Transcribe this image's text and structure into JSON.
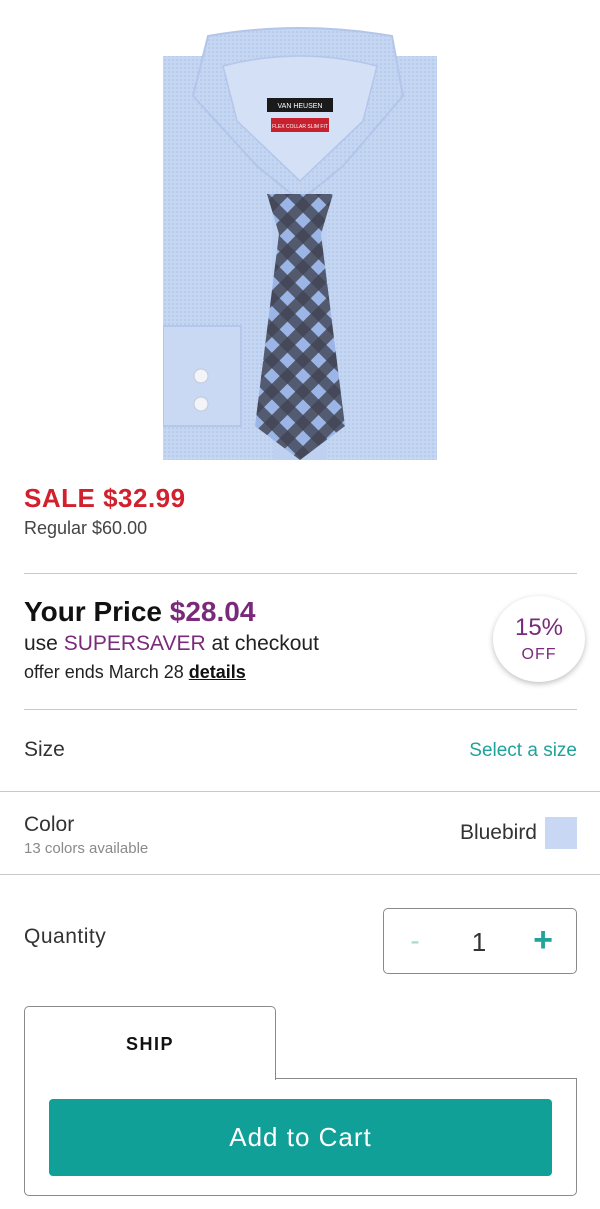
{
  "product": {
    "image_icon": "dress-shirt-with-tie-image",
    "brand_tag": "VAN HEUSEN",
    "fit_tag": "FLEX COLLAR SLIM FIT"
  },
  "pricing": {
    "sale": "SALE $32.99",
    "regular": "Regular $60.00",
    "your_price_label": "Your Price",
    "your_price_amount": "$28.04",
    "promo_prefix": "use",
    "promo_code": "SUPERSAVER",
    "promo_suffix": "at checkout",
    "offer_text": "offer ends March 28",
    "details_link": "details",
    "badge_percent": "15%",
    "badge_off": "OFF"
  },
  "size": {
    "label": "Size",
    "select_label": "Select a size"
  },
  "color": {
    "label": "Color",
    "available": "13 colors available",
    "value": "Bluebird",
    "swatch_color": "#c8d8f4"
  },
  "quantity": {
    "label": "Quantity",
    "minus": "-",
    "value": "1",
    "plus": "+"
  },
  "fulfillment": {
    "tab_label": "SHIP",
    "add_to_cart": "Add to Cart"
  },
  "colors": {
    "sale_red": "#d1202e",
    "promo_purple": "#7a2a7a",
    "teal": "#11a098"
  }
}
